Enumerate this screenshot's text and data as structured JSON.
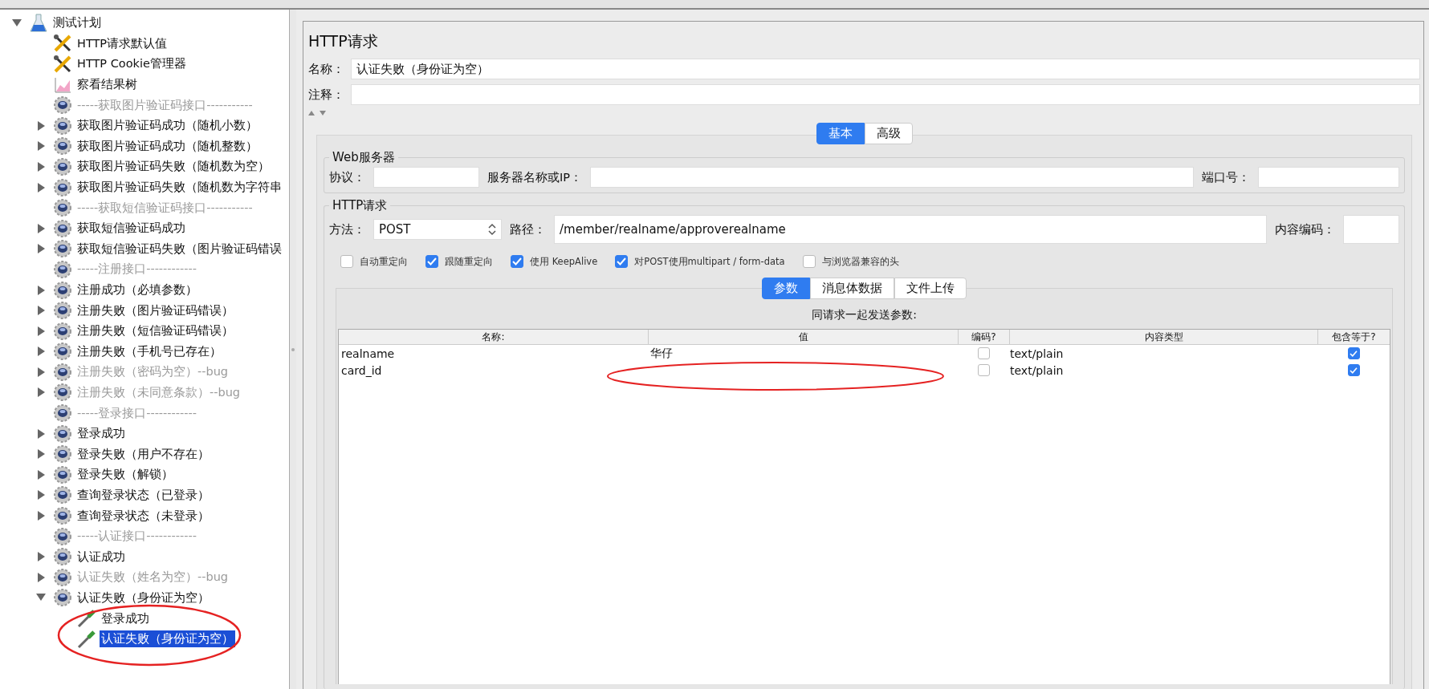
{
  "tree": [
    {
      "label": "测试计划",
      "kind": "plan",
      "expanded": true,
      "disabled": false,
      "selected": false,
      "children": [
        {
          "label": "HTTP请求默认值",
          "kind": "config",
          "disabled": false,
          "selected": false
        },
        {
          "label": "HTTP Cookie管理器",
          "kind": "config",
          "disabled": false,
          "selected": false
        },
        {
          "label": "察看结果树",
          "kind": "listener",
          "disabled": false,
          "selected": false
        },
        {
          "label": "-----获取图片验证码接口-----------",
          "kind": "controller",
          "disabled": true,
          "selected": false
        },
        {
          "label": "获取图片验证码成功（随机小数）",
          "kind": "controller",
          "expanded": false,
          "disabled": false,
          "selected": false
        },
        {
          "label": "获取图片验证码成功（随机整数）",
          "kind": "controller",
          "expanded": false,
          "disabled": false,
          "selected": false
        },
        {
          "label": "获取图片验证码失败（随机数为空）",
          "kind": "controller",
          "expanded": false,
          "disabled": false,
          "selected": false
        },
        {
          "label": "获取图片验证码失败（随机数为字符串",
          "kind": "controller",
          "expanded": false,
          "disabled": false,
          "selected": false
        },
        {
          "label": "-----获取短信验证码接口-----------",
          "kind": "controller",
          "disabled": true,
          "selected": false
        },
        {
          "label": "获取短信验证码成功",
          "kind": "controller",
          "expanded": false,
          "disabled": false,
          "selected": false
        },
        {
          "label": "获取短信验证码失败（图片验证码错误",
          "kind": "controller",
          "expanded": false,
          "disabled": false,
          "selected": false
        },
        {
          "label": "-----注册接口------------",
          "kind": "controller",
          "disabled": true,
          "selected": false
        },
        {
          "label": "注册成功（必填参数）",
          "kind": "controller",
          "expanded": false,
          "disabled": false,
          "selected": false
        },
        {
          "label": "注册失败（图片验证码错误）",
          "kind": "controller",
          "expanded": false,
          "disabled": false,
          "selected": false
        },
        {
          "label": "注册失败（短信验证码错误）",
          "kind": "controller",
          "expanded": false,
          "disabled": false,
          "selected": false
        },
        {
          "label": "注册失败（手机号已存在）",
          "kind": "controller",
          "expanded": false,
          "disabled": false,
          "selected": false
        },
        {
          "label": "注册失败（密码为空）--bug",
          "kind": "controller",
          "expanded": false,
          "disabled": true,
          "selected": false
        },
        {
          "label": "注册失败（未同意条款）--bug",
          "kind": "controller",
          "expanded": false,
          "disabled": true,
          "selected": false
        },
        {
          "label": "-----登录接口------------",
          "kind": "controller",
          "disabled": true,
          "selected": false
        },
        {
          "label": "登录成功",
          "kind": "controller",
          "expanded": false,
          "disabled": false,
          "selected": false
        },
        {
          "label": "登录失败（用户不存在）",
          "kind": "controller",
          "expanded": false,
          "disabled": false,
          "selected": false
        },
        {
          "label": "登录失败（解锁）",
          "kind": "controller",
          "expanded": false,
          "disabled": false,
          "selected": false
        },
        {
          "label": "查询登录状态（已登录）",
          "kind": "controller",
          "expanded": false,
          "disabled": false,
          "selected": false
        },
        {
          "label": "查询登录状态（未登录）",
          "kind": "controller",
          "expanded": false,
          "disabled": false,
          "selected": false
        },
        {
          "label": "-----认证接口------------",
          "kind": "controller",
          "disabled": true,
          "selected": false
        },
        {
          "label": "认证成功",
          "kind": "controller",
          "expanded": false,
          "disabled": false,
          "selected": false
        },
        {
          "label": "认证失败（姓名为空）--bug",
          "kind": "controller",
          "expanded": false,
          "disabled": true,
          "selected": false
        },
        {
          "label": "认证失败（身份证为空）",
          "kind": "controller",
          "expanded": true,
          "disabled": false,
          "selected": false,
          "children": [
            {
              "label": "登录成功",
              "kind": "sampler",
              "disabled": false,
              "selected": false
            },
            {
              "label": "认证失败（身份证为空）",
              "kind": "sampler",
              "disabled": false,
              "selected": true
            }
          ]
        }
      ]
    }
  ],
  "editor": {
    "title": "HTTP请求",
    "name_label": "名称：",
    "name_value": "认证失败（身份证为空）",
    "comment_label": "注释：",
    "tabs": [
      {
        "label": "基本",
        "selected": true
      },
      {
        "label": "高级",
        "selected": false
      }
    ],
    "web_server": {
      "legend": "Web服务器",
      "protocol_label": "协议：",
      "server_label": "服务器名称或IP：",
      "port_label": "端口号："
    },
    "http_request": {
      "legend": "HTTP请求",
      "method_label": "方法：",
      "method_value": "POST",
      "path_label": "路径：",
      "path_value": "/member/realname/approverealname",
      "encoding_label": "内容编码：",
      "options": [
        {
          "label": "自动重定向",
          "checked": false
        },
        {
          "label": "跟随重定向",
          "checked": true
        },
        {
          "label": "使用 KeepAlive",
          "checked": true
        },
        {
          "label": "对POST使用multipart / form-data",
          "checked": true
        },
        {
          "label": "与浏览器兼容的头",
          "checked": false
        }
      ]
    },
    "param_tabs": [
      {
        "label": "参数",
        "selected": true
      },
      {
        "label": "消息体数据",
        "selected": false
      },
      {
        "label": "文件上传",
        "selected": false
      }
    ],
    "params": {
      "title": "同请求一起发送参数:",
      "columns": [
        "名称:",
        "值",
        "编码?",
        "内容类型",
        "包含等于?"
      ],
      "rows": [
        {
          "name": "realname",
          "value": "华仔",
          "encode": false,
          "content_type": "text/plain",
          "include_equals": true
        },
        {
          "name": "card_id",
          "encode": false,
          "content_type": "text/plain",
          "include_equals": true
        }
      ]
    }
  }
}
